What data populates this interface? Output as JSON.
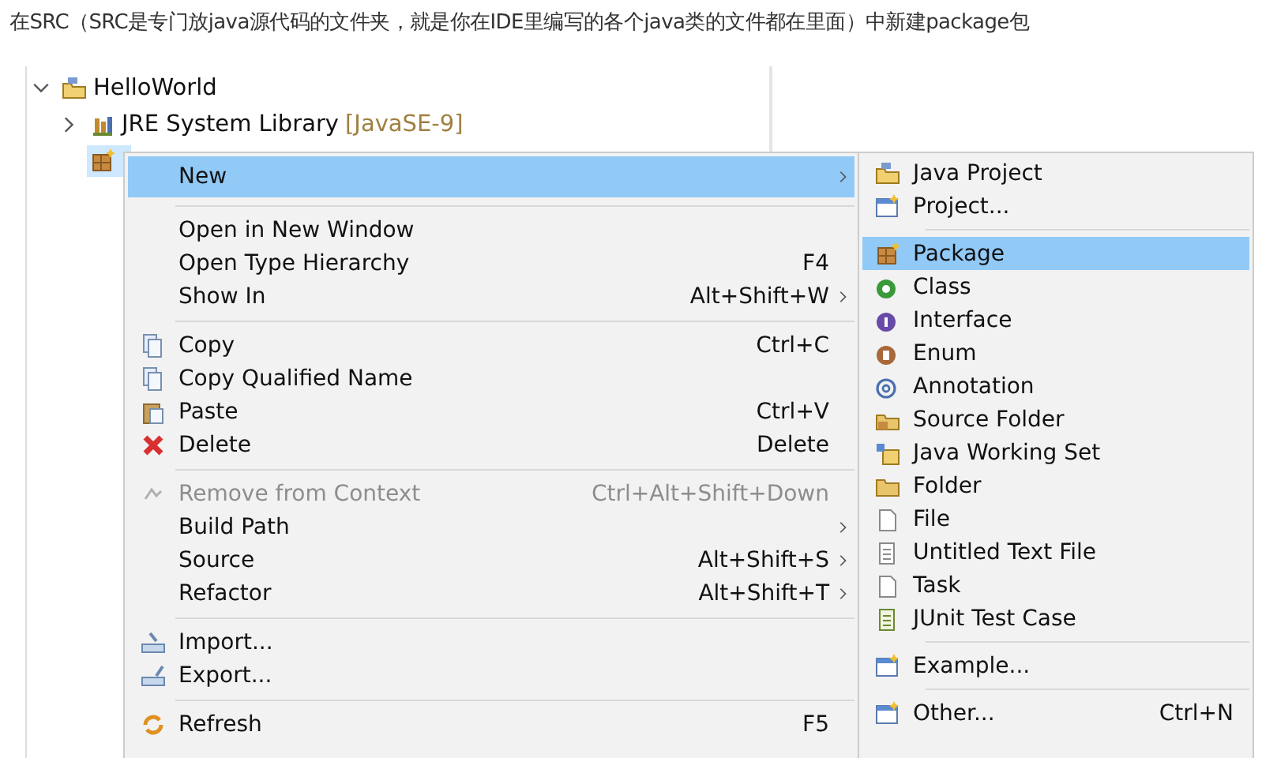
{
  "caption": "在SRC（SRC是专门放java源代码的文件夹，就是你在IDE里编写的各个java类的文件都在里面）中新建package包",
  "tree": [
    {
      "label": "HelloWorld",
      "expanded": true,
      "selected": false,
      "children": [
        {
          "label": "JRE System Library",
          "decoration": "[JavaSE-9]",
          "expanded": false,
          "selected": false
        },
        {
          "selected": true
        }
      ]
    }
  ],
  "context_menu": {
    "items": [
      {
        "kind": "item",
        "label": "New",
        "submenu": true,
        "selected": true,
        "disabled": false
      },
      {
        "kind": "separator"
      },
      {
        "kind": "item",
        "label": "Open in New Window",
        "submenu": false,
        "selected": false,
        "disabled": false
      },
      {
        "kind": "item",
        "label": "Open Type Hierarchy",
        "shortcut": "F4",
        "submenu": false,
        "selected": false,
        "disabled": false
      },
      {
        "kind": "item",
        "label": "Show In",
        "shortcut": "Alt+Shift+W",
        "submenu": true,
        "selected": false,
        "disabled": false
      },
      {
        "kind": "separator"
      },
      {
        "kind": "item",
        "label": "Copy",
        "shortcut": "Ctrl+C",
        "submenu": false,
        "selected": false,
        "disabled": false
      },
      {
        "kind": "item",
        "label": "Copy Qualified Name",
        "submenu": false,
        "selected": false,
        "disabled": false
      },
      {
        "kind": "item",
        "label": "Paste",
        "shortcut": "Ctrl+V",
        "submenu": false,
        "selected": false,
        "disabled": false
      },
      {
        "kind": "item",
        "label": "Delete",
        "shortcut": "Delete",
        "submenu": false,
        "selected": false,
        "disabled": false
      },
      {
        "kind": "separator"
      },
      {
        "kind": "item",
        "label": "Remove from Context",
        "shortcut": "Ctrl+Alt+Shift+Down",
        "submenu": false,
        "selected": false,
        "disabled": true
      },
      {
        "kind": "item",
        "label": "Build Path",
        "submenu": true,
        "selected": false,
        "disabled": false
      },
      {
        "kind": "item",
        "label": "Source",
        "shortcut": "Alt+Shift+S",
        "submenu": true,
        "selected": false,
        "disabled": false
      },
      {
        "kind": "item",
        "label": "Refactor",
        "shortcut": "Alt+Shift+T",
        "submenu": true,
        "selected": false,
        "disabled": false
      },
      {
        "kind": "separator"
      },
      {
        "kind": "item",
        "label": "Import...",
        "submenu": false,
        "selected": false,
        "disabled": false
      },
      {
        "kind": "item",
        "label": "Export...",
        "submenu": false,
        "selected": false,
        "disabled": false
      },
      {
        "kind": "separator"
      },
      {
        "kind": "item",
        "label": "Refresh",
        "shortcut": "F5",
        "submenu": false,
        "selected": false,
        "disabled": false
      }
    ]
  },
  "new_submenu": {
    "items": [
      {
        "kind": "item",
        "label": "Java Project",
        "selected": false
      },
      {
        "kind": "item",
        "label": "Project...",
        "selected": false
      },
      {
        "kind": "separator"
      },
      {
        "kind": "item",
        "label": "Package",
        "selected": true
      },
      {
        "kind": "item",
        "label": "Class",
        "selected": false
      },
      {
        "kind": "item",
        "label": "Interface",
        "selected": false
      },
      {
        "kind": "item",
        "label": "Enum",
        "selected": false
      },
      {
        "kind": "item",
        "label": "Annotation",
        "selected": false
      },
      {
        "kind": "item",
        "label": "Source Folder",
        "selected": false
      },
      {
        "kind": "item",
        "label": "Java Working Set",
        "selected": false
      },
      {
        "kind": "item",
        "label": "Folder",
        "selected": false
      },
      {
        "kind": "item",
        "label": "File",
        "selected": false
      },
      {
        "kind": "item",
        "label": "Untitled Text File",
        "selected": false
      },
      {
        "kind": "item",
        "label": "Task",
        "selected": false
      },
      {
        "kind": "item",
        "label": "JUnit Test Case",
        "selected": false
      },
      {
        "kind": "separator"
      },
      {
        "kind": "item",
        "label": "Example...",
        "selected": false
      },
      {
        "kind": "separator"
      },
      {
        "kind": "item",
        "label": "Other...",
        "shortcut": "Ctrl+N",
        "selected": false
      }
    ]
  }
}
